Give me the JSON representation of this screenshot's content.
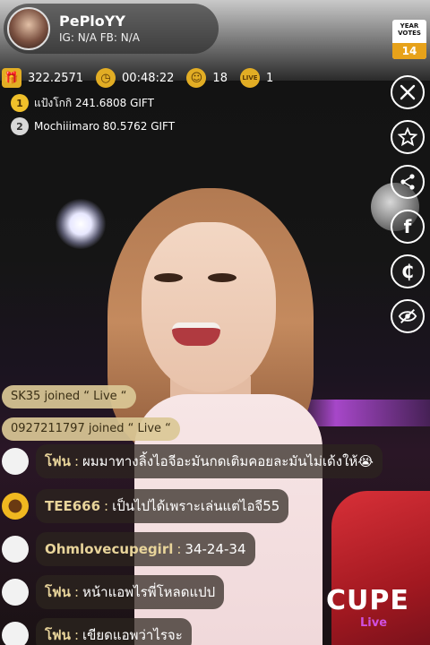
{
  "host": {
    "name": "PePloYY",
    "social": "IG: N/A  FB: N/A"
  },
  "year_votes": {
    "label_line1": "YEAR",
    "label_line2": "VOTES",
    "count": "14"
  },
  "stats": {
    "gift_total": "322.2571",
    "duration": "00:48:22",
    "viewers": "18",
    "live_icon_label": "LIVE",
    "live_count": "1"
  },
  "ranking": [
    {
      "rank": "1",
      "text": "แป้งโกกิ 241.6808 GIFT"
    },
    {
      "rank": "2",
      "text": "Mochiiimaro 80.5762 GIFT"
    }
  ],
  "actions": [
    {
      "icon": "close-icon"
    },
    {
      "icon": "star-icon"
    },
    {
      "icon": "share-icon"
    },
    {
      "icon": "facebook-icon"
    },
    {
      "icon": "coin-icon"
    },
    {
      "icon": "hide-icon"
    }
  ],
  "joins": [
    "SK35 joined “ Live “",
    "0927211797 joined “ Live “"
  ],
  "chat": [
    {
      "user": "โฟน",
      "message": "ผมมาทางลิ้งไอจีอะมันกดเติมคอยละมันไม่เด้งให้😭",
      "avatar": "blank"
    },
    {
      "user": "TEE666",
      "message": "เป็นไปได้เพราะเล่นแต่ไอจี55",
      "avatar": "sunflower"
    },
    {
      "user": "Ohmlovecupegirl",
      "message": "34-24-34",
      "avatar": "blank"
    },
    {
      "user": "โฟน",
      "message": "หน้าแอพไรพี่โหลดแปป",
      "avatar": "blank"
    },
    {
      "user": "โฟน",
      "message": "เขียดแอพว่าไรจะ",
      "avatar": "blank"
    }
  ],
  "logo": {
    "main": "CUPE",
    "sub": "Live"
  },
  "colors": {
    "join_bg": "#dac896",
    "username": "#e8d49a",
    "gold": "#e2ad24",
    "logo_accent": "#d050e0"
  }
}
